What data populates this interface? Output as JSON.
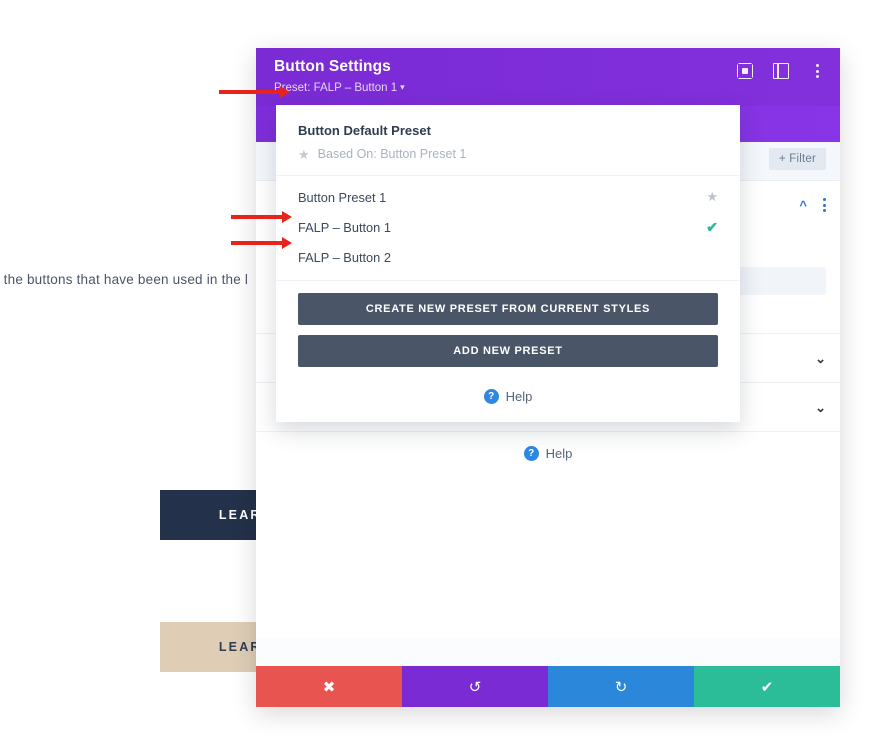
{
  "background": {
    "paragraph": "d the buttons that have been used in the l",
    "buttons": [
      {
        "label": "LEARN M",
        "style": "dark"
      },
      {
        "label": "LEARN M",
        "style": "tan"
      }
    ]
  },
  "modal": {
    "title": "Button Settings",
    "preset_label": "Preset: FALP – Button 1",
    "preset_caret": "▾",
    "header_icons": [
      {
        "name": "focus-mode-icon"
      },
      {
        "name": "split-view-icon"
      },
      {
        "name": "more-options-icon"
      }
    ],
    "toolbar": {
      "filter_label": "+ Filter"
    },
    "body": {
      "help_label": "Help",
      "help_badge": "?"
    },
    "footer": {
      "cancel_icon": "✖",
      "undo_icon": "↺",
      "redo_icon": "↻",
      "save_icon": "✔"
    }
  },
  "preset_dropdown": {
    "default_title": "Button Default Preset",
    "based_on": "Based On: Button Preset 1",
    "star_icon": "★",
    "items": [
      {
        "label": "Button Preset 1",
        "marker": "star",
        "marker_glyph": "★"
      },
      {
        "label": "FALP – Button 1",
        "marker": "check",
        "marker_glyph": "✔"
      },
      {
        "label": "FALP – Button 2",
        "marker": "none",
        "marker_glyph": ""
      }
    ],
    "create_button": "CREATE NEW PRESET FROM CURRENT STYLES",
    "add_button": "ADD NEW PRESET",
    "help_label": "Help",
    "help_badge": "?"
  },
  "annotations": {
    "arrow_color": "#e8231c",
    "arrows": [
      {
        "target": "preset-label"
      },
      {
        "target": "falp-button-1"
      },
      {
        "target": "falp-button-2"
      }
    ]
  }
}
